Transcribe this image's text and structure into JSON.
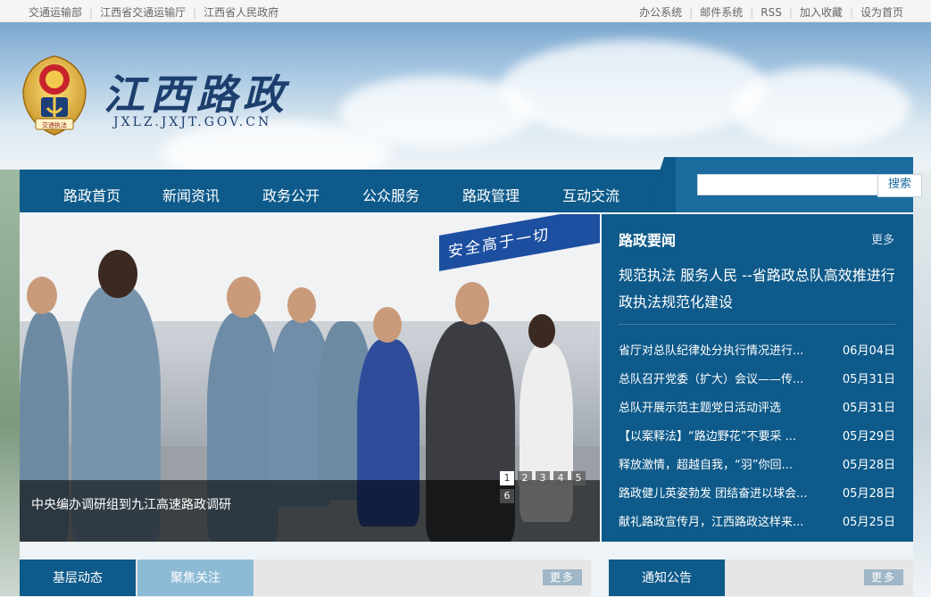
{
  "topbar": {
    "left_links": [
      "交通运输部",
      "江西省交通运输厅",
      "江西省人民政府"
    ],
    "right_links": [
      "办公系统",
      "邮件系统",
      "RSS",
      "加入收藏",
      "设为首页"
    ]
  },
  "header": {
    "title": "江西路政",
    "domain": "JXLZ.JXJT.GOV.CN",
    "emblem_text": "交通执法"
  },
  "nav": {
    "items": [
      "路政首页",
      "新闻资讯",
      "政务公开",
      "公众服务",
      "路政管理",
      "互动交流"
    ],
    "search_button": "搜索",
    "search_value": ""
  },
  "slider": {
    "caption": "中央编办调研组到九江高速路政调研",
    "sign_text": "安全高于一切",
    "pages": [
      "1",
      "2",
      "3",
      "4",
      "5",
      "6"
    ],
    "active_page": "1"
  },
  "news": {
    "heading": "路政要闻",
    "more": "更多",
    "headline": "规范执法 服务人民 --省路政总队高效推进行政执法规范化建设",
    "items": [
      {
        "title": "省厅对总队纪律处分执行情况进行...",
        "date": "06月04日"
      },
      {
        "title": "总队召开党委（扩大）会议——传...",
        "date": "05月31日"
      },
      {
        "title": "总队开展示范主题党日活动评选",
        "date": "05月31日"
      },
      {
        "title": "【以案释法】“路边野花”不要采 ...",
        "date": "05月29日"
      },
      {
        "title": "释放激情，超越自我，“羽”你回...",
        "date": "05月28日"
      },
      {
        "title": "路政健儿英姿勃发 团结奋进以球会...",
        "date": "05月28日"
      },
      {
        "title": "献礼路政宣传月，江西路政这样来...",
        "date": "05月25日"
      }
    ]
  },
  "bottom": {
    "tab_grassroots": "基层动态",
    "tab_focus": "聚焦关注",
    "more_left": "更多",
    "tab_notice": "通知公告",
    "more_right": "更多"
  },
  "colors": {
    "primary": "#0e5a8a",
    "secondary": "#8dbbd6"
  }
}
